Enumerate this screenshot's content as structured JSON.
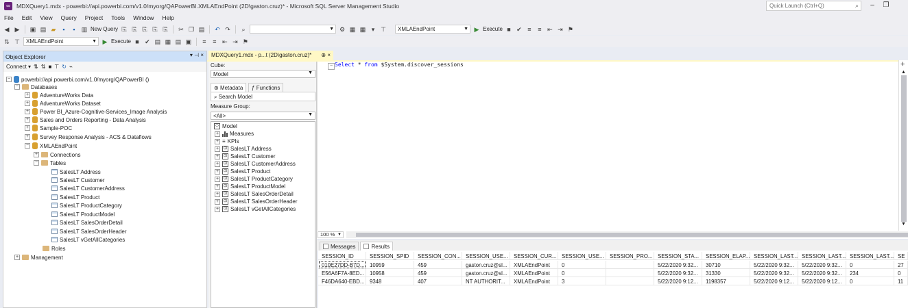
{
  "window": {
    "title": "MDXQuery1.mdx - powerbi://api.powerbi.com/v1.0/myorg/QAPowerBI.XMLAEndPoint (2D\\gaston.cruz)* - Microsoft SQL Server Management Studio",
    "quick_launch": "Quick Launch (Ctrl+Q)"
  },
  "menu": [
    "File",
    "Edit",
    "View",
    "Query",
    "Project",
    "Tools",
    "Window",
    "Help"
  ],
  "toolbar1": {
    "new_query": "New Query",
    "db_combo": "",
    "server_combo": "XMLAEndPoint",
    "execute": "Execute"
  },
  "toolbar2": {
    "db_combo": "XMLAEndPoint",
    "execute": "Execute"
  },
  "object_explorer": {
    "title": "Object Explorer",
    "connect": "Connect",
    "server": "powerbi://api.powerbi.com/v1.0/myorg/QAPowerBI ()",
    "databases_label": "Databases",
    "databases": [
      "AdventureWorks Data",
      "AdventureWorks Dataset",
      "Power BI_Azure-Cognitive-Services_Image Analysis",
      "Sales and Orders Reporting - Data Analysis",
      "Sample-POC",
      "Survey Response Analysis - ACS & Dataflows",
      "XMLAEndPoint"
    ],
    "connections": "Connections",
    "tables_label": "Tables",
    "tables": [
      "SalesLT Address",
      "SalesLT Customer",
      "SalesLT CustomerAddress",
      "SalesLT Product",
      "SalesLT ProductCategory",
      "SalesLT ProductModel",
      "SalesLT SalesOrderDetail",
      "SalesLT SalesOrderHeader",
      "SalesLT vGetAllCategories"
    ],
    "roles": "Roles",
    "management": "Management"
  },
  "doc_tab": {
    "label": "MDXQuery1.mdx - p...t (2D\\gaston.cruz)*",
    "pin": "⊕",
    "close": "×"
  },
  "metadata": {
    "cube_label": "Cube:",
    "cube_value": "Model",
    "tab_metadata": "Metadata",
    "tab_functions": "Functions",
    "search": "Search Model",
    "measure_group_label": "Measure Group:",
    "measure_group_value": "<All>",
    "root": "Model",
    "measures": "Measures",
    "kpis": "KPIs",
    "tables": [
      "SalesLT Address",
      "SalesLT Customer",
      "SalesLT CustomerAddress",
      "SalesLT Product",
      "SalesLT ProductCategory",
      "SalesLT ProductModel",
      "SalesLT SalesOrderDetail",
      "SalesLT SalesOrderHeader",
      "SalesLT vGetAllCategories"
    ]
  },
  "editor": {
    "line_marker": "−",
    "kw_select": "Select",
    "star": " * ",
    "kw_from": "from",
    "rest": " $System.discover_sessions"
  },
  "zoom": "100 %",
  "results_tabs": {
    "messages": "Messages",
    "results": "Results"
  },
  "grid": {
    "headers": [
      "SESSION_ID",
      "SESSION_SPID",
      "SESSION_CON...",
      "SESSION_USE...",
      "SESSION_CUR...",
      "SESSION_USE...",
      "SESSION_PRO...",
      "SESSION_STA...",
      "SESSION_ELAP...",
      "SESSION_LAST...",
      "SESSION_LAST...",
      "SESSION_LAST...",
      "SE"
    ],
    "rows": [
      [
        "010E27DD-B7D...",
        "10959",
        "459",
        "gaston.cruz@sl...",
        "XMLAEndPoint",
        "0",
        "",
        "5/22/2020 9:32...",
        "30710",
        "5/22/2020 9:32...",
        "5/22/2020 9:32...",
        "0",
        "27"
      ],
      [
        "E56A6F7A-8ED...",
        "10958",
        "459",
        "gaston.cruz@sl...",
        "XMLAEndPoint",
        "0",
        "",
        "5/22/2020 9:32...",
        "31330",
        "5/22/2020 9:32...",
        "5/22/2020 9:32...",
        "234",
        "0"
      ],
      [
        "F46DA640-EBD...",
        "9348",
        "407",
        "NT AUTHORIT...",
        "XMLAEndPoint",
        "3",
        "",
        "5/22/2020 9:12...",
        "1198357",
        "5/22/2020 9:12...",
        "5/22/2020 9:12...",
        "0",
        "11"
      ]
    ]
  }
}
